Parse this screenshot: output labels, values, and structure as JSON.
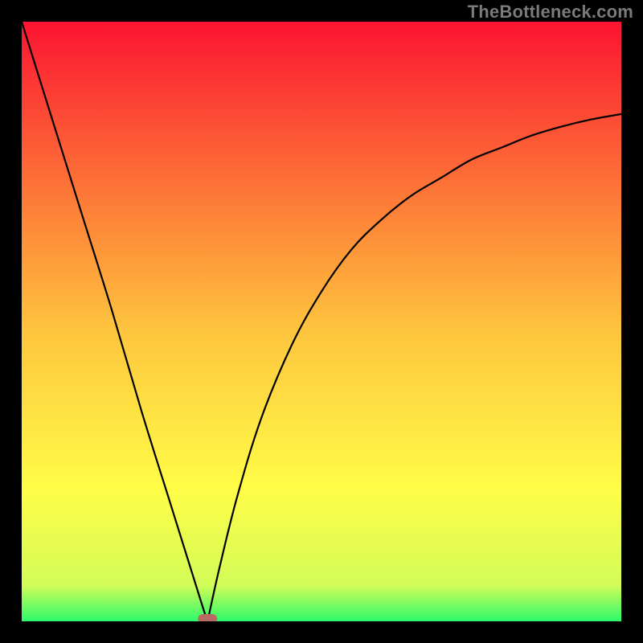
{
  "watermark": "TheBottleneck.com",
  "colors": {
    "top": "#fc1432",
    "q1": "#fd7537",
    "mid": "#fec63e",
    "q3": "#fffd47",
    "nearBottom": "#d3fc58",
    "bottom": "#2cf96a",
    "curve": "#000000",
    "blob": "#b96b63",
    "frame": "#000000"
  },
  "chart_data": {
    "type": "line",
    "title": "",
    "xlabel": "",
    "ylabel": "",
    "xlim": [
      0,
      100
    ],
    "ylim": [
      0,
      100
    ],
    "grid": false,
    "legend": false,
    "annotations": [
      {
        "text": "TheBottleneck.com",
        "position": "top-right"
      }
    ],
    "min_point": {
      "x": 31,
      "y": 0
    },
    "series": [
      {
        "name": "left-branch",
        "x": [
          0,
          5,
          10,
          15,
          20,
          25,
          30,
          31
        ],
        "y": [
          100,
          84,
          68,
          52,
          35,
          19,
          3,
          0
        ]
      },
      {
        "name": "right-branch",
        "x": [
          31,
          33,
          36,
          40,
          45,
          50,
          55,
          60,
          65,
          70,
          75,
          80,
          85,
          90,
          95,
          100
        ],
        "y": [
          0,
          9,
          21,
          34,
          46,
          55,
          62,
          67,
          71,
          74,
          77,
          79,
          81,
          82.5,
          83.7,
          84.6
        ]
      }
    ],
    "marker": {
      "name": "optimum-blob",
      "x": 31,
      "y": 0,
      "shape": "rounded-rect"
    }
  }
}
